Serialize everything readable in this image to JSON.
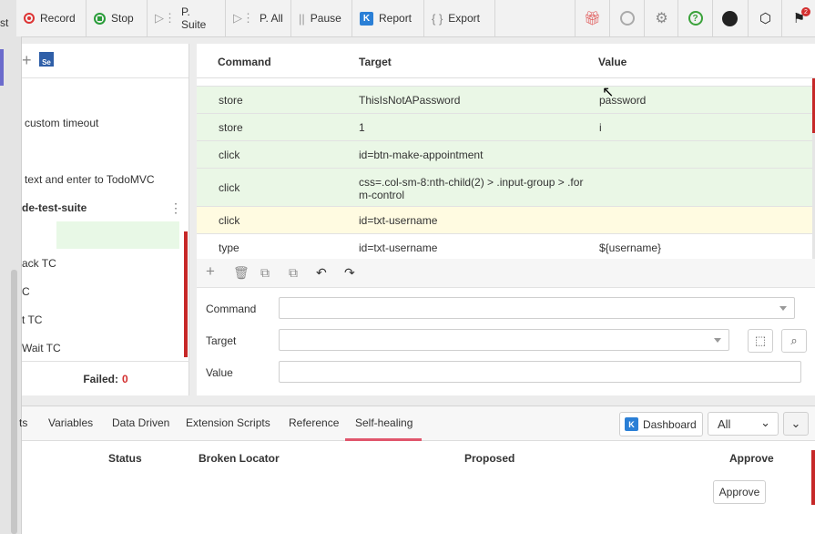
{
  "left_sidebar": {
    "cut_text": "st"
  },
  "toolbar": {
    "record": "Record",
    "stop": "Stop",
    "play_suite": "P. Suite",
    "play_all": "P. All",
    "pause": "Pause",
    "report": "Report",
    "export": "Export",
    "icons": [
      "gift-icon",
      "speedometer-icon",
      "gear-icon",
      "help-icon",
      "github-icon",
      "cube-icon",
      "notification-icon"
    ],
    "notification_count": "2"
  },
  "testcases": {
    "items": [
      "custom timeout",
      "text and enter to TodoMVC",
      "de-test-suite",
      "ack TC",
      "C",
      "t TC",
      "Wait TC"
    ],
    "footer_label": "Failed:",
    "failed_count": "0"
  },
  "table": {
    "headers": {
      "command": "Command",
      "target": "Target",
      "value": "Value"
    },
    "rows": [
      {
        "command": "store",
        "target": "ThisIsNotAPassword",
        "value": "password"
      },
      {
        "command": "store",
        "target": "1",
        "value": "i"
      },
      {
        "command": "click",
        "target": "id=btn-make-appointment",
        "value": ""
      },
      {
        "command": "click",
        "target": "css=.col-sm-8:nth-child(2) > .input-group > .for",
        "target2": "m-control",
        "value": ""
      },
      {
        "command": "click",
        "target": "id=txt-username",
        "value": ""
      },
      {
        "command": "type",
        "target": "id=txt-username",
        "value": "${username}"
      }
    ]
  },
  "editor": {
    "command_label": "Command",
    "target_label": "Target",
    "value_label": "Value",
    "command_value": "",
    "target_value": "",
    "value_value": ""
  },
  "bottom": {
    "tabs": [
      "ts",
      "Variables",
      "Data Driven",
      "Extension Scripts",
      "Reference",
      "Self-healing"
    ],
    "active_tab": "Self-healing",
    "dashboard": "Dashboard",
    "filter": "All",
    "columns": {
      "status": "Status",
      "broken_locator": "Broken Locator",
      "proposed": "Proposed",
      "approve": "Approve"
    },
    "approve_button": "Approve"
  }
}
